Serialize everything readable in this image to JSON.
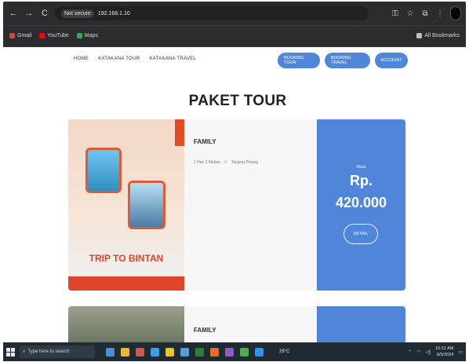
{
  "browser": {
    "nav": {
      "back": "←",
      "forward": "→",
      "reload": "C"
    },
    "address": {
      "security_badge": "Not secure",
      "url": "192.168.1.10"
    },
    "toolbar_icons": [
      "key-icon",
      "star-icon",
      "extension-icon",
      "profile-icon"
    ],
    "bookmarks": [
      {
        "label": "Gmail",
        "color": "#d44638"
      },
      {
        "label": "YouTube",
        "color": "#ff0000"
      },
      {
        "label": "Maps",
        "color": "#34a853"
      }
    ],
    "bookmarks_right": "All Bookmarks"
  },
  "site": {
    "nav_links": [
      "HOME",
      "KATAKANA TOUR",
      "KATAKANA TRAVEL"
    ],
    "nav_buttons": [
      "BOOKING TOUR",
      "BOOKING TRAVEL",
      "ACCOUNT"
    ],
    "page_title": "PAKET TOUR",
    "accent": "#4f86d9",
    "packages": [
      {
        "name": "FAMILY",
        "image_text": "TRIP TO BINTAN",
        "meta": [
          "1 Hari 1 Malam",
          "Tanjung Pinang"
        ],
        "price_label": "Mulai",
        "currency": "Rp.",
        "price": "420.000",
        "button": "DETAIL"
      },
      {
        "name": "FAMILY"
      }
    ]
  },
  "taskbar": {
    "search_placeholder": "Type here to search",
    "weather": "29°C",
    "time": "10:12 AM",
    "date": "6/5/2024"
  }
}
